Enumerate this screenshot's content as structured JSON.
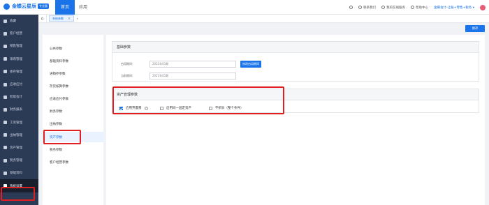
{
  "topbar": {
    "brand": "金蝶云星辰",
    "brand_badge": "专业版",
    "tabs": [
      {
        "label": "首页"
      },
      {
        "label": "应用"
      }
    ],
    "right": {
      "contact": "联系我们",
      "service": "我的在线服务",
      "help": "帮助中心",
      "company": "金蝶会计-让账+零售+税务 ▾"
    }
  },
  "sidebar": {
    "items": [
      {
        "label": "收藏"
      },
      {
        "label": "客户经营"
      },
      {
        "label": "销售管理"
      },
      {
        "label": "采购管理"
      },
      {
        "label": "库存管理"
      },
      {
        "label": "应收应付"
      },
      {
        "label": "智能会计"
      },
      {
        "label": "财务报表"
      },
      {
        "label": "工资管理"
      },
      {
        "label": "出纳管理"
      },
      {
        "label": "资产管理"
      },
      {
        "label": "税务管理"
      },
      {
        "label": "基础资料"
      },
      {
        "label": "系统设置"
      }
    ],
    "active_index": 13
  },
  "tabstrip": {
    "tab_label": "系统参数",
    "close": "×",
    "chevron": "∨"
  },
  "toolbar": {
    "save_label": "保存"
  },
  "menu": {
    "items": [
      {
        "label": "公共参数"
      },
      {
        "label": "基础资料参数"
      },
      {
        "label": "进销存参数"
      },
      {
        "label": "存货核算参数"
      },
      {
        "label": "应收应付参数"
      },
      {
        "label": "财务参数"
      },
      {
        "label": "出纳参数"
      },
      {
        "label": "资产参数"
      },
      {
        "label": "税务参数"
      },
      {
        "label": "客户经营参数"
      }
    ],
    "selected_index": 7
  },
  "basic_panel": {
    "title": "基础参数",
    "enable_period_label": "启用期间:",
    "enable_period_value": "2021年01期",
    "current_period_label": "当前期间:",
    "current_period_value": "2021年01期",
    "edit_button": "修改启用期间"
  },
  "asset_panel": {
    "title": "资产管理参数",
    "options": [
      {
        "label": "启用弃置费",
        "checked": true
      },
      {
        "label": "启用同一固定资产",
        "checked": false
      },
      {
        "label": "不折旧（整个条件）",
        "checked": false
      }
    ]
  },
  "colors": {
    "accent": "#1a73e8",
    "sidebar": "#2b3a55",
    "highlight": "#e02020"
  }
}
